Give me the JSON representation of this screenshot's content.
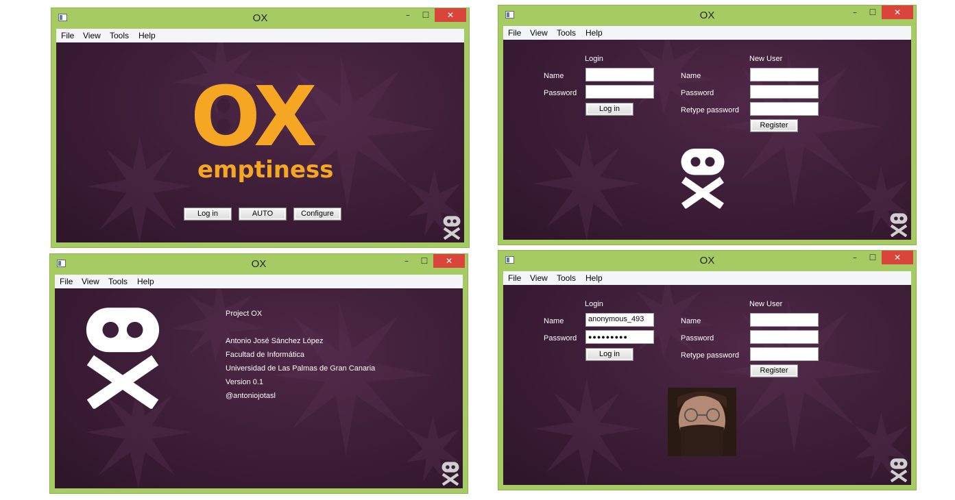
{
  "app_title": "OX",
  "window_controls": {
    "minimize": "–",
    "maximize": "☐",
    "close": "✕"
  },
  "menu": [
    "File",
    "View",
    "Tools",
    "Help"
  ],
  "splash": {
    "logo_text": "OX",
    "subtitle": "emptiness",
    "buttons": [
      "Log in",
      "AUTO",
      "Configure"
    ]
  },
  "about": {
    "lines": [
      "Project OX",
      "Antonio José Sánchez López",
      "Facultad de Informática",
      "Universidad de Las Palmas de Gran Canaria",
      "Version 0.1",
      "@antoniojotasl"
    ]
  },
  "login_form": {
    "login_heading": "Login",
    "new_user_heading": "New User",
    "name_label": "Name",
    "password_label": "Password",
    "retype_label": "Retype password",
    "login_button": "Log in",
    "register_button": "Register"
  },
  "login_filled": {
    "name_value": "anonymous_493",
    "password_mask": "●●●●●●●●●"
  },
  "colors": {
    "frame": "#a6cb63",
    "background": "#3e1f39",
    "logo_orange": "#f5a623",
    "close": "#d9453a"
  },
  "icons": [
    "app-icon",
    "minimize-icon",
    "maximize-icon",
    "close-icon",
    "ox-watermark-icon",
    "ox-logo-icon",
    "user-photo"
  ]
}
